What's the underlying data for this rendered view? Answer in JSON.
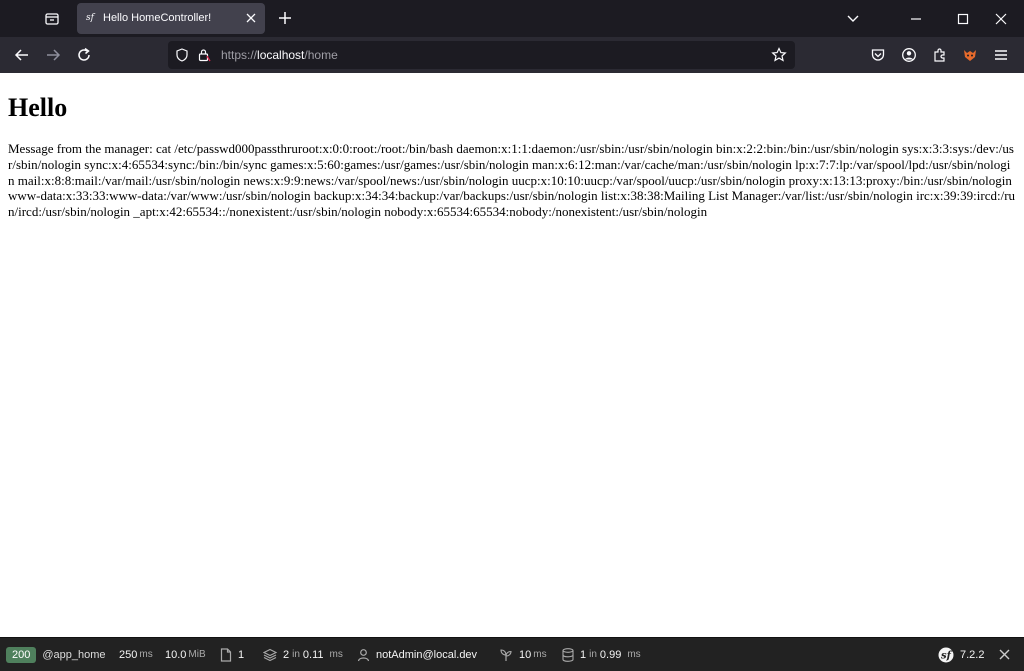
{
  "browser": {
    "tab": {
      "title": "Hello HomeController!",
      "favicon": "sf"
    },
    "url": {
      "scheme": "https://",
      "host": "localhost",
      "path": "/home"
    },
    "icons": [
      "tab-list-icon",
      "close-icon",
      "plus-icon",
      "chevron-down-icon",
      "minimize-icon",
      "maximize-icon",
      "back-arrow-icon",
      "forward-arrow-icon",
      "reload-icon",
      "shield-icon",
      "lock-icon",
      "bookmark-star-icon",
      "pocket-icon",
      "account-icon",
      "extensions-icon",
      "firefox-relay-icon",
      "hamburger-menu-icon"
    ]
  },
  "page": {
    "heading": "Hello",
    "message": "Message from the manager: cat /etc/passwd000passthruroot:x:0:0:root:/root:/bin/bash daemon:x:1:1:daemon:/usr/sbin:/usr/sbin/nologin bin:x:2:2:bin:/bin:/usr/sbin/nologin sys:x:3:3:sys:/dev:/usr/sbin/nologin sync:x:4:65534:sync:/bin:/bin/sync games:x:5:60:games:/usr/games:/usr/sbin/nologin man:x:6:12:man:/var/cache/man:/usr/sbin/nologin lp:x:7:7:lp:/var/spool/lpd:/usr/sbin/nologin mail:x:8:8:mail:/var/mail:/usr/sbin/nologin news:x:9:9:news:/var/spool/news:/usr/sbin/nologin uucp:x:10:10:uucp:/var/spool/uucp:/usr/sbin/nologin proxy:x:13:13:proxy:/bin:/usr/sbin/nologin www-data:x:33:33:www-data:/var/www:/usr/sbin/nologin backup:x:34:34:backup:/var/backups:/usr/sbin/nologin list:x:38:38:Mailing List Manager:/var/list:/usr/sbin/nologin irc:x:39:39:ircd:/run/ircd:/usr/sbin/nologin _apt:x:42:65534::/nonexistent:/usr/sbin/nologin nobody:x:65534:65534:nobody:/nonexistent:/usr/sbin/nologin"
  },
  "toolbar": {
    "status_code": "200",
    "route": "@app_home",
    "time": {
      "value": "250",
      "unit": "ms"
    },
    "memory": {
      "value": "10.0",
      "unit": "MiB"
    },
    "forms": {
      "value": "1"
    },
    "cache": {
      "value": "2",
      "label": "in",
      "time": "0.11",
      "unit": "ms"
    },
    "user": "notAdmin@local.dev",
    "twig": {
      "value": "10",
      "unit": "ms"
    },
    "db": {
      "value": "1",
      "label": "in",
      "time": "0.99",
      "unit": "ms"
    },
    "symfony_version": "7.2.2",
    "colors": {
      "status_green": "#4f805d",
      "bg": "#222222"
    }
  }
}
